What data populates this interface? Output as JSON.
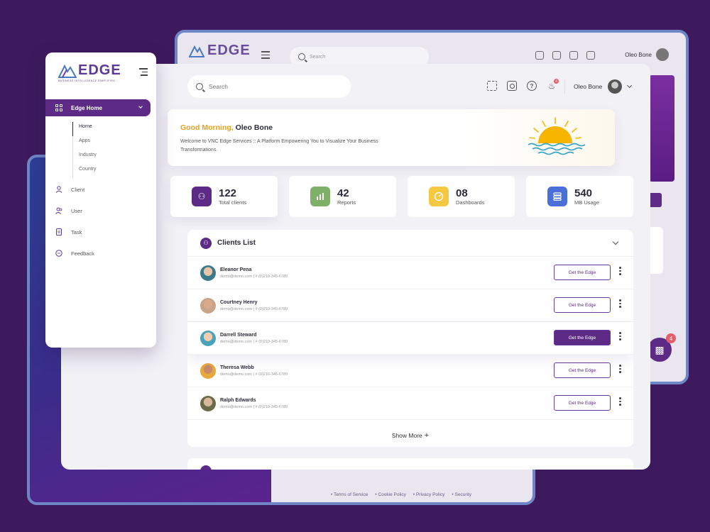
{
  "back_panel": {
    "search_placeholder": "Search",
    "user_name": "Oleo Bone",
    "footer_links": [
      "Terms of Service",
      "Cookie Policy",
      "Privacy Policy",
      "Security"
    ]
  },
  "chat": {
    "badge": "4"
  },
  "sidebar": {
    "logo_text": "EDGE",
    "logo_tagline": "BUSINESS INTELLIGENCE SIMPLIFIED",
    "active_item": "Edge Home",
    "sub_items": [
      "Home",
      "Apps",
      "Industry",
      "Country"
    ],
    "items": [
      {
        "label": "Client",
        "icon": "user-icon"
      },
      {
        "label": "User",
        "icon": "users-icon"
      },
      {
        "label": "Task",
        "icon": "document-icon"
      },
      {
        "label": "Feedback",
        "icon": "chat-icon"
      }
    ]
  },
  "topbar": {
    "search_placeholder": "Search",
    "notification_count": "4",
    "user_name": "Oleo Bone"
  },
  "greeting": {
    "hello": "Good Morning,",
    "name": "Oleo Bone",
    "message": "Welcome to VNC Edge Services :: A Platform Empowering You to Visualize Your Business Transformations."
  },
  "stats": [
    {
      "value": "122",
      "label": "Total clients",
      "color": "#5d2b86",
      "icon": "users-icon"
    },
    {
      "value": "42",
      "label": "Reports",
      "color": "#7fb069",
      "icon": "bar-chart-icon"
    },
    {
      "value": "08",
      "label": "Dashboards",
      "color": "#f5c842",
      "icon": "gauge-icon"
    },
    {
      "value": "540",
      "label": "MB Usage",
      "color": "#4a6fd8",
      "icon": "database-icon"
    }
  ],
  "clients": {
    "title": "Clients List",
    "button_label": "Get the Edge",
    "show_more": "Show More",
    "rows": [
      {
        "name": "Eleanor Pena",
        "info": "demo@demo.com | # (0)210-345-6789",
        "avatar_color": "#3b7a8c"
      },
      {
        "name": "Courtney Henry",
        "info": "demo@demo.com | # (0)210-345-6789",
        "avatar_color": "#c9a48a"
      },
      {
        "name": "Darrell Steward",
        "info": "demo@demo.com | # (0)210-345-6789",
        "avatar_color": "#4aa3b8"
      },
      {
        "name": "Theresa Webb",
        "info": "demo@demo.com | # (0)210-345-6789",
        "avatar_color": "#e8a83a"
      },
      {
        "name": "Ralph Edwards",
        "info": "demo@demo.com | # (0)210-345-6789",
        "avatar_color": "#6b6b4a"
      }
    ]
  }
}
